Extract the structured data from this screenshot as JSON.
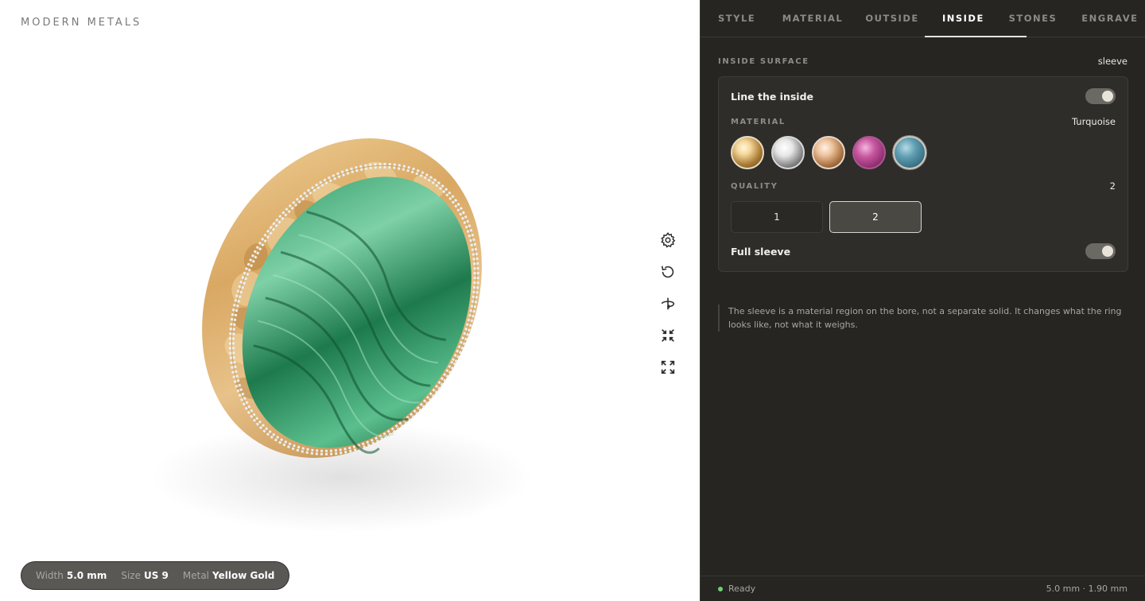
{
  "brand": "MODERN METALS",
  "tabs": [
    {
      "label": "STYLE",
      "active": false
    },
    {
      "label": "MATERIAL",
      "active": false
    },
    {
      "label": "OUTSIDE",
      "active": false
    },
    {
      "label": "INSIDE",
      "active": true
    },
    {
      "label": "STONES",
      "active": false
    },
    {
      "label": "ENGRAVE",
      "active": false
    }
  ],
  "inside_surface": {
    "label": "INSIDE SURFACE",
    "value": "sleeve"
  },
  "line_inside": {
    "label": "Line the inside",
    "enabled": true
  },
  "material": {
    "label": "MATERIAL",
    "selected": "Turquoise",
    "swatches": [
      {
        "name": "yellow-gold",
        "color": "#d9b56f"
      },
      {
        "name": "white-metal",
        "color": "#c9c9c9"
      },
      {
        "name": "rose-gold",
        "color": "#d6a078"
      },
      {
        "name": "pink",
        "color": "#b44a8e"
      },
      {
        "name": "turquoise",
        "color": "#4f8ea3",
        "selected": true
      }
    ]
  },
  "quality": {
    "label": "QUALITY",
    "value": "2",
    "options": [
      "1",
      "2"
    ],
    "selected": "2"
  },
  "full_sleeve": {
    "label": "Full sleeve",
    "enabled": true
  },
  "note": "The sleeve is a material region on the bore, not a separate solid. It changes what the ring looks like, not what it weighs.",
  "status": {
    "text": "Ready",
    "dims": "5.0 mm · 1.90 mm",
    "color": "#6fcf73"
  },
  "specs": [
    {
      "label": "Width",
      "value": "5.0 mm"
    },
    {
      "label": "Size",
      "value": "US 9"
    },
    {
      "label": "Metal",
      "value": "Yellow Gold"
    }
  ],
  "viewer_tools": [
    "settings-icon",
    "rotate-reset-icon",
    "spin-icon",
    "collapse-icon",
    "expand-icon"
  ]
}
